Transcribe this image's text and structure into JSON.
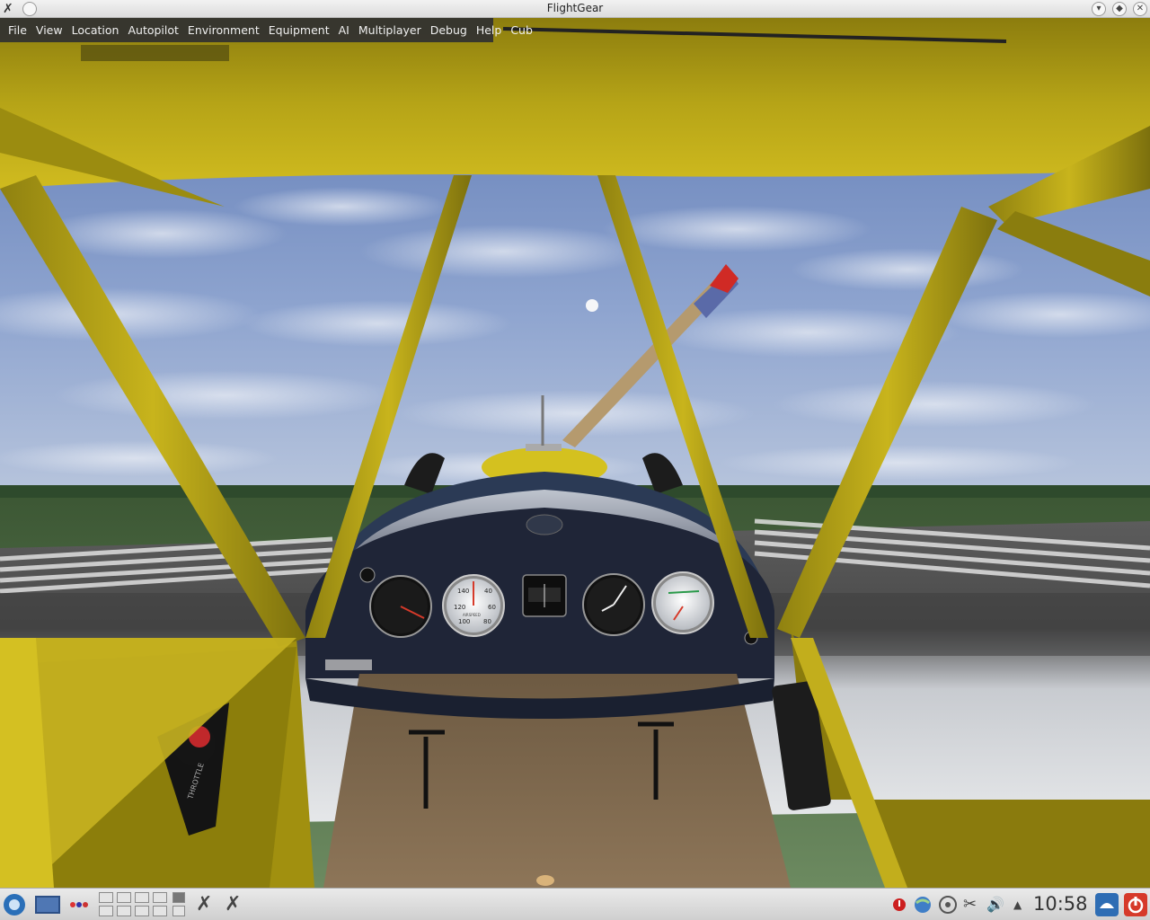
{
  "window": {
    "title": "FlightGear"
  },
  "menubar": {
    "items": [
      "File",
      "View",
      "Location",
      "Autopilot",
      "Environment",
      "Equipment",
      "AI",
      "Multiplayer",
      "Debug",
      "Help",
      "Cub"
    ]
  },
  "cockpit": {
    "throttle_label": "THROTTLE",
    "gauges": {
      "airspeed_ticks": [
        "40",
        "60",
        "80",
        "100",
        "120",
        "140"
      ],
      "airspeed_caption": "AIRSPEED"
    }
  },
  "taskbar": {
    "clock": "10:58",
    "icons": [
      "start-menu-icon",
      "desktop-icon",
      "color-dots-icon",
      "pager-icon",
      "flightgear-icon",
      "flightgear-icon",
      "alert-icon",
      "network-icon",
      "joystick-icon",
      "clipboard-icon",
      "volume-icon",
      "expand-tray-icon",
      "lock-screen-icon",
      "power-icon"
    ]
  },
  "colors": {
    "fuselage_yellow": "#c9b51a",
    "sky": "#7f98c7",
    "panel": "#1f2537",
    "menubar_bg": "#303030"
  }
}
